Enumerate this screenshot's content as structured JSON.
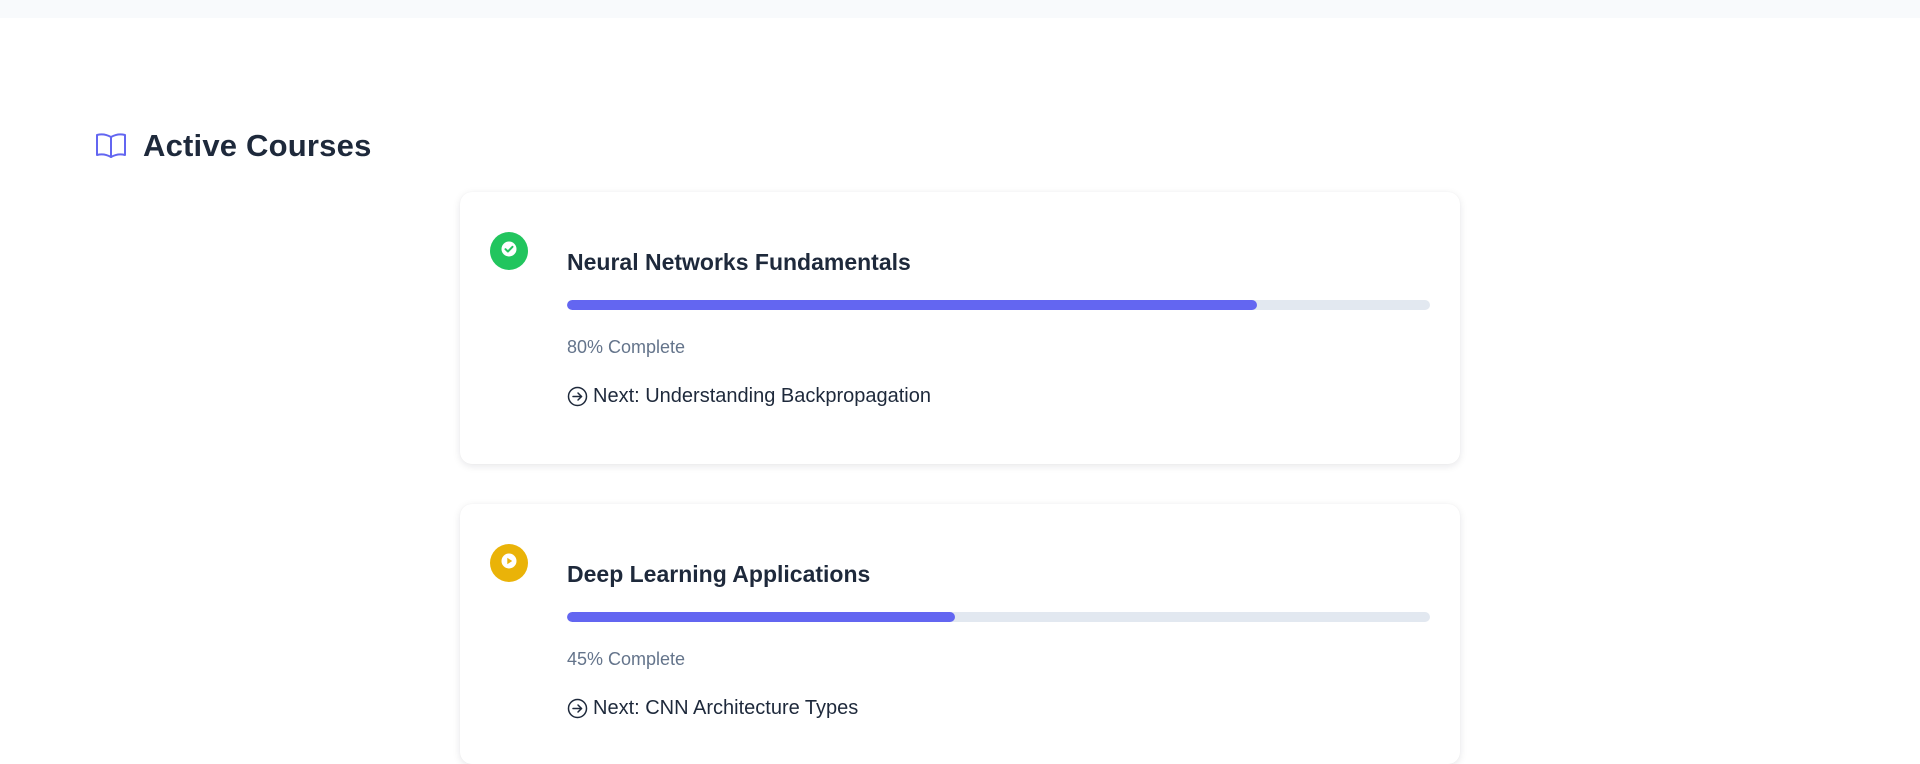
{
  "section": {
    "title": "Active Courses",
    "icon": "book-open-icon",
    "accent_color": "#6366f1"
  },
  "courses": [
    {
      "title": "Neural Networks Fundamentals",
      "progress_percent": 80,
      "progress_label": "80% Complete",
      "next_label": "Next: Understanding Backpropagation",
      "status_icon": "check-icon",
      "status_color": "#22c55e",
      "progress_color": "#6366f1"
    },
    {
      "title": "Deep Learning Applications",
      "progress_percent": 45,
      "progress_label": "45% Complete",
      "next_label": "Next: CNN Architecture Types",
      "status_icon": "play-icon",
      "status_color": "#eab308",
      "progress_color": "#6366f1"
    }
  ]
}
